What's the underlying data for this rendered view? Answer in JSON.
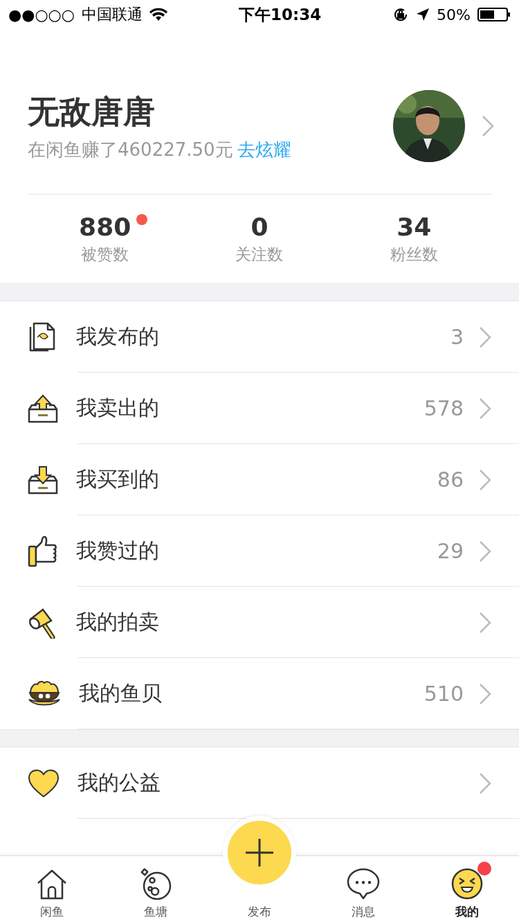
{
  "status_bar": {
    "signal": "●●○○○",
    "carrier": "中国联通",
    "time": "下午10:34",
    "battery": "50%"
  },
  "profile": {
    "name": "无敌唐唐",
    "earnings": "在闲鱼赚了460227.50元",
    "link": "去炫耀"
  },
  "stats": [
    {
      "value": "880",
      "label": "被赞数",
      "dot": true
    },
    {
      "value": "0",
      "label": "关注数",
      "dot": false
    },
    {
      "value": "34",
      "label": "粉丝数",
      "dot": false
    }
  ],
  "menu_groups": [
    [
      {
        "label": "我发布的",
        "count": "3"
      },
      {
        "label": "我卖出的",
        "count": "578"
      },
      {
        "label": "我买到的",
        "count": "86"
      },
      {
        "label": "我赞过的",
        "count": "29"
      },
      {
        "label": "我的拍卖"
      },
      {
        "label": "我的鱼贝",
        "count": "510"
      }
    ],
    [
      {
        "label": "我的公益"
      }
    ]
  ],
  "tabs": [
    {
      "label": "闲鱼",
      "kind": "home",
      "selected": false,
      "dot": false
    },
    {
      "label": "鱼塘",
      "kind": "pond",
      "selected": false,
      "dot": false
    },
    {
      "label": "发布",
      "kind": "publish",
      "selected": false,
      "dot": false
    },
    {
      "label": "消息",
      "kind": "message",
      "selected": false,
      "dot": false
    },
    {
      "label": "我的",
      "kind": "me",
      "selected": true,
      "dot": true
    }
  ]
}
